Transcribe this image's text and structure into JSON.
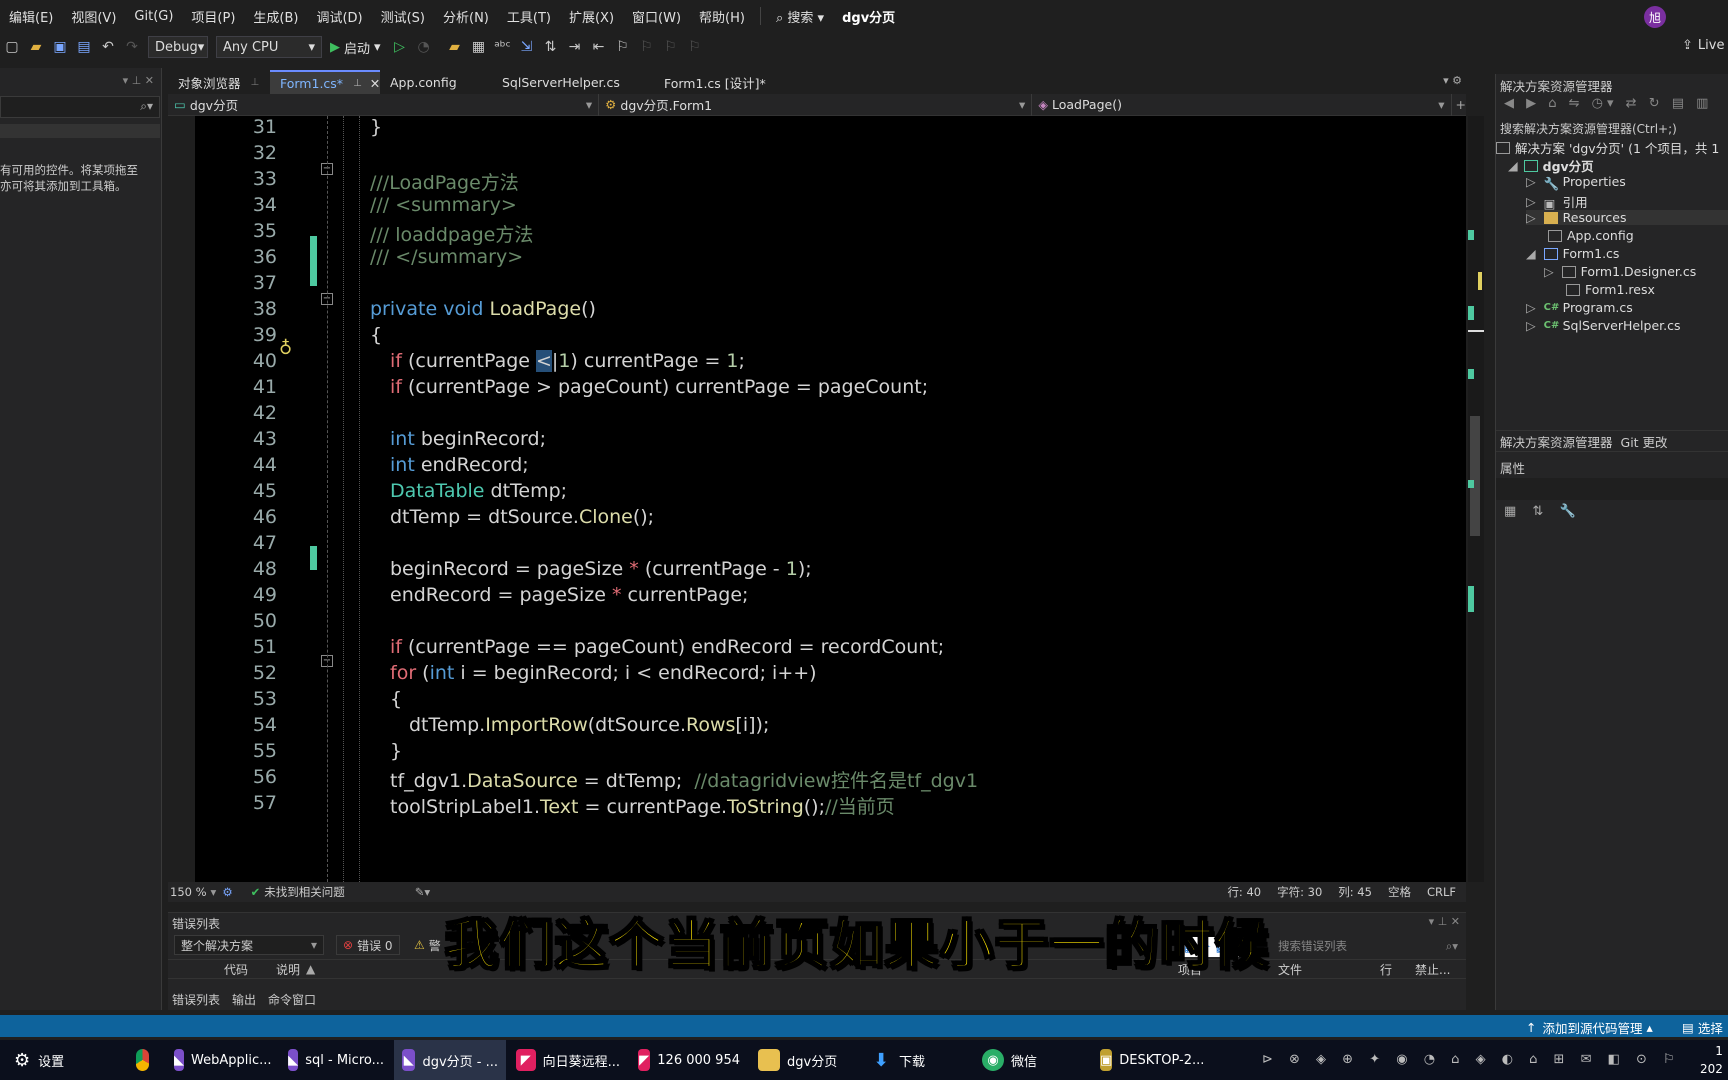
{
  "menu": {
    "items": [
      "编辑(E)",
      "视图(V)",
      "Git(G)",
      "项目(P)",
      "生成(B)",
      "调试(D)",
      "测试(S)",
      "分析(N)",
      "工具(T)",
      "扩展(X)",
      "窗口(W)",
      "帮助(H)"
    ],
    "search": "搜索",
    "solution_title": "dgv分页",
    "avatar": "旭"
  },
  "toolbar": {
    "config": "Debug",
    "platform": "Any CPU",
    "start": "启动",
    "live": "Live"
  },
  "left_panel": {
    "hint1": "有可用的控件。将某项拖至",
    "hint2": "亦可将其添加到工具箱。"
  },
  "tabs": [
    {
      "label": "对象浏览器"
    },
    {
      "label": "Form1.cs*"
    },
    {
      "label": "App.config"
    },
    {
      "label": "SqlServerHelper.cs"
    },
    {
      "label": "Form1.cs [设计]*"
    }
  ],
  "navbar": {
    "project": "dgv分页",
    "class": "dgv分页.Form1",
    "member": "LoadPage()"
  },
  "editor": {
    "line_numbers": [
      "31",
      "32",
      "33",
      "34",
      "35",
      "36",
      "37",
      "38",
      "39",
      "40",
      "41",
      "42",
      "43",
      "44",
      "45",
      "46",
      "47",
      "48",
      "49",
      "50",
      "51",
      "52",
      "53",
      "54",
      "55",
      "56",
      "57"
    ]
  },
  "edstatus": {
    "zoom": "150 %",
    "issues": "未找到相关问题",
    "line": "行: 40",
    "char": "字符: 30",
    "col": "列: 45",
    "space": "空格",
    "eol": "CRLF"
  },
  "errlist": {
    "title": "错误列表",
    "scope": "整个解决方案",
    "errors": "错误 0",
    "warn": "警",
    "col_code": "代码",
    "col_desc": "说明",
    "col_project": "项目",
    "col_file": "文件",
    "col_line": "行",
    "col_suppress": "禁止...",
    "search": "搜索错误列表",
    "tab_err": "错误列表",
    "tab_out": "输出",
    "tab_cmd": "命令窗口"
  },
  "solution": {
    "title": "解决方案资源管理器",
    "search": "搜索解决方案资源管理器(Ctrl+;)",
    "root": "解决方案 'dgv分页' (1 个项目，共 1",
    "items": [
      "dgv分页",
      "Properties",
      "引用",
      "Resources",
      "App.config",
      "Form1.cs",
      "Form1.Designer.cs",
      "Form1.resx",
      "Program.cs",
      "SqlServerHelper.cs"
    ],
    "tab1": "解决方案资源管理器",
    "tab2": "Git 更改",
    "props": "属性"
  },
  "subtitle": "我们这个当前页如果小于一的时候",
  "statusbar": {
    "source_control": "添加到源代码管理",
    "select": "选择"
  },
  "taskbar": {
    "settings": "设置",
    "apps": [
      {
        "label": "WebApplic..."
      },
      {
        "label": "sql - Micro..."
      },
      {
        "label": "dgv分页 - ..."
      },
      {
        "label": "向日葵远程..."
      },
      {
        "label": "126 000 954"
      },
      {
        "label": "dgv分页"
      },
      {
        "label": "下载"
      },
      {
        "label": "微信"
      },
      {
        "label": "DESKTOP-2..."
      }
    ],
    "time": "1",
    "date": "202"
  }
}
